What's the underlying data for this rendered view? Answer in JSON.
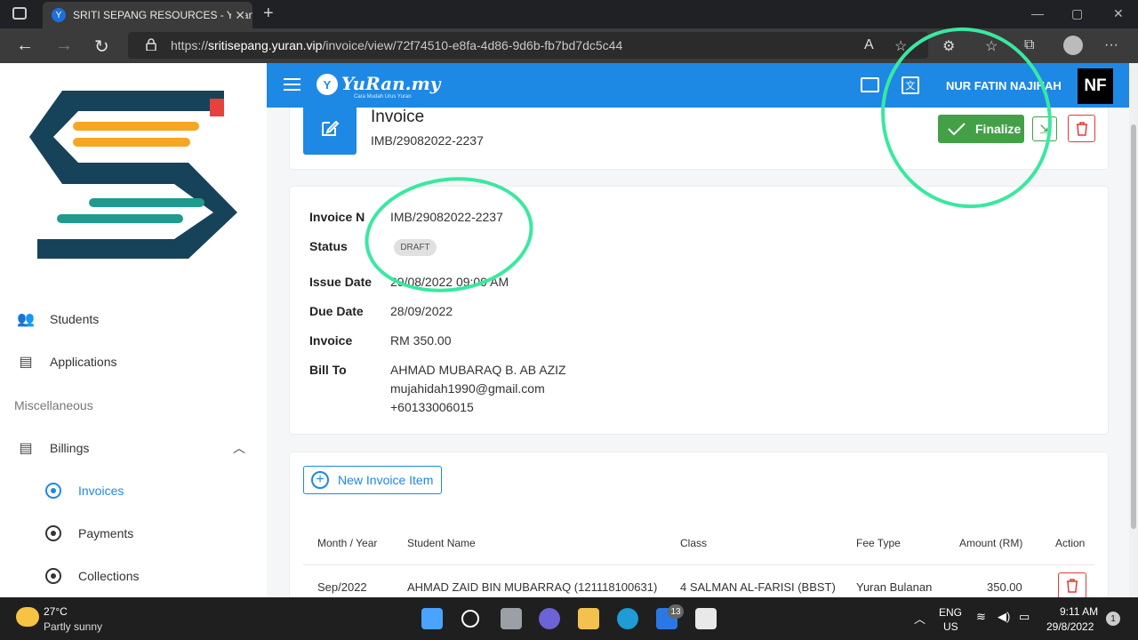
{
  "browser": {
    "tab_title": "SRITI SEPANG RESOURCES - Yuran",
    "url_prefix": "https://",
    "url_host": "sritisepang.yuran.vip",
    "url_path": "/invoice/view/72f74510-e8fa-4d86-9d6b-fb7bd7dc5c44"
  },
  "appbar": {
    "logo_text": "YuRan.my",
    "logo_tagline": "Cara Mudah Urus Yuran",
    "user_name": "NUR FATIN NAJIHAH",
    "user_initials": "NF"
  },
  "sidebar": {
    "items": [
      {
        "label": "Students",
        "icon": "students-icon"
      },
      {
        "label": "Applications",
        "icon": "document-icon"
      }
    ],
    "section_label": "Miscellaneous",
    "billings_label": "Billings",
    "sub_items": [
      {
        "label": "Invoices",
        "active": true
      },
      {
        "label": "Payments",
        "active": false
      },
      {
        "label": "Collections",
        "active": false
      }
    ]
  },
  "invoice_header": {
    "title": "Invoice",
    "number": "IMB/29082022-2237",
    "finalize_label": "Finalize"
  },
  "details": {
    "labels": [
      "Invoice No",
      "Status",
      "Issue Date",
      "Due Date",
      "Invoice",
      "Bill To"
    ],
    "invoice_no": "IMB/29082022-2237",
    "status": "DRAFT",
    "issue_date": "29/08/2022 09:09 AM",
    "due_date": "28/09/2022",
    "invoice_amount": "RM 350.00",
    "bill_to_name": "AHMAD MUBARAQ B. AB AZIZ",
    "bill_to_email": "mujahidah1990@gmail.com",
    "bill_to_phone": "+60133006015"
  },
  "items": {
    "new_item_label": "New Invoice Item",
    "columns": [
      "Month / Year",
      "Student Name",
      "Class",
      "Fee Type",
      "Amount (RM)",
      "Action"
    ],
    "rows": [
      {
        "month": "Sep/2022",
        "student": "AHMAD ZAID BIN MUBARRAQ (121118100631)",
        "class": "4 SALMAN AL-FARISI (BBST)",
        "fee_type": "Yuran Bulanan",
        "amount": "350.00"
      }
    ]
  },
  "taskbar": {
    "temperature": "27°C",
    "weather": "Partly sunny",
    "lang_top": "ENG",
    "lang_bottom": "US",
    "time": "9:11 AM",
    "date": "29/8/2022",
    "mail_badge": "13",
    "notif_badge": "1"
  },
  "colors": {
    "primary": "#1e88e5",
    "finalize": "#43a047",
    "delete": "#e53935",
    "annotation": "#3ae8a0"
  }
}
